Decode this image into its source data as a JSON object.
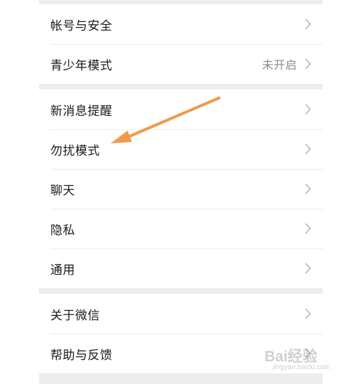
{
  "settings": {
    "group1": [
      {
        "label": "帐号与安全",
        "value": ""
      },
      {
        "label": "青少年模式",
        "value": "未开启"
      }
    ],
    "group2": [
      {
        "label": "新消息提醒",
        "value": ""
      },
      {
        "label": "勿扰模式",
        "value": ""
      },
      {
        "label": "聊天",
        "value": ""
      },
      {
        "label": "隐私",
        "value": ""
      },
      {
        "label": "通用",
        "value": ""
      }
    ],
    "group3": [
      {
        "label": "关于微信",
        "value": ""
      },
      {
        "label": "帮助与反馈",
        "value": ""
      }
    ]
  },
  "annotation": {
    "arrow_color": "#ef9a4a"
  },
  "watermark": {
    "brand": "Bai经验",
    "domain": "jingyan.baidu.com"
  }
}
